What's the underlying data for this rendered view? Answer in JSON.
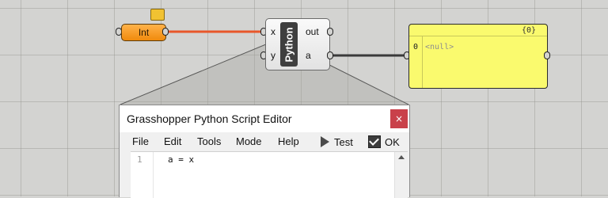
{
  "canvas": {
    "int_component": {
      "label": "Int"
    },
    "python_component": {
      "title": "Python",
      "inputs": [
        "x",
        "y"
      ],
      "outputs": [
        "out",
        "a"
      ]
    },
    "panel": {
      "header": "{0}",
      "row_index": "0",
      "row_value": "<null>"
    }
  },
  "editor": {
    "title": "Grasshopper Python Script Editor",
    "close_glyph": "×",
    "menu": [
      "File",
      "Edit",
      "Tools",
      "Mode",
      "Help"
    ],
    "test_label": "Test",
    "ok_label": "OK",
    "code": {
      "line_number": "1",
      "line_text": "a = x"
    }
  },
  "colors": {
    "canvas_bg": "#d3d3d1",
    "wire_active": "#e8572a",
    "wire_normal": "#3a3a3a",
    "int_fill": "#f59a1e",
    "panel_fill": "#fafa6e",
    "close_button": "#c9414a"
  },
  "icons": [
    "play-icon",
    "ok-check-icon",
    "close-icon",
    "scroll-up-icon"
  ]
}
